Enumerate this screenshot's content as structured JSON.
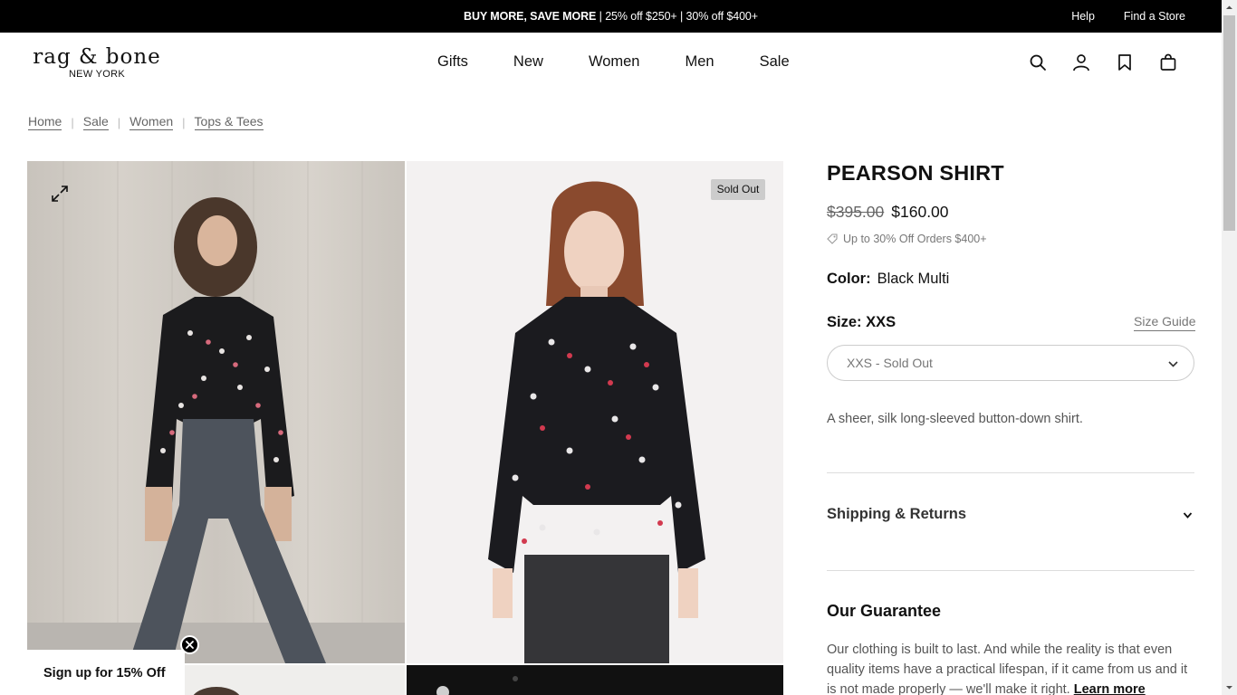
{
  "promo": {
    "highlight": "BUY MORE, SAVE MORE",
    "details": " | 25% off $250+ | 30% off $400+",
    "help": "Help",
    "find_store": "Find a Store"
  },
  "header": {
    "logo_main": "rag & bone",
    "logo_sub": "NEW YORK",
    "nav": [
      "Gifts",
      "New",
      "Women",
      "Men",
      "Sale"
    ],
    "icons": [
      "search-icon",
      "account-icon",
      "wishlist-icon",
      "bag-icon"
    ]
  },
  "breadcrumb": [
    "Home",
    "Sale",
    "Women",
    "Tops & Tees"
  ],
  "gallery": {
    "badge": "Sold Out"
  },
  "signup": {
    "label": "Sign up for 15% Off"
  },
  "product": {
    "title": "PEARSON SHIRT",
    "price_original": "$395.00",
    "price_sale": "$160.00",
    "promo_note": "Up to 30% Off Orders $400+",
    "color_label": "Color:",
    "color_value": "Black Multi",
    "size_label": "Size:",
    "size_value": "XXS",
    "size_guide": "Size Guide",
    "size_selected": "XXS - Sold Out",
    "description": "A sheer, silk long-sleeved button-down shirt.",
    "shipping_title": "Shipping & Returns",
    "guarantee_title": "Our Guarantee",
    "guarantee_body": "Our clothing is built to last. And while the reality is that even quality items have a practical lifespan, if it came from us and it is not made properly — we'll make it right. ",
    "learn_more": "Learn more"
  },
  "colors": {
    "promo_bg": "#000000",
    "badge_bg": "#cccccc",
    "text": "#111111",
    "muted": "#777777"
  }
}
